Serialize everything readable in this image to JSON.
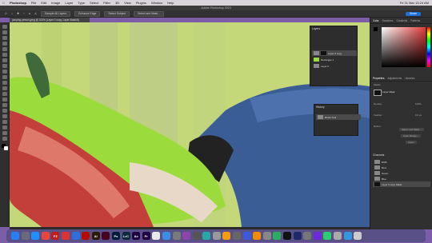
{
  "menubar": {
    "app_name": "Photoshop",
    "items": [
      "File",
      "Edit",
      "Image",
      "Layer",
      "Type",
      "Select",
      "Filter",
      "3D",
      "View",
      "Plugins",
      "Window",
      "Help"
    ],
    "clock": "Fri 31 Mar  13:24 AM"
  },
  "window": {
    "title": "Adobe Photoshop 2023"
  },
  "options_bar": {
    "btn1": "Sample All Layers",
    "btn2": "Enhance Edge",
    "btn3": "Select Subject",
    "btn4": "Select and Mask...",
    "share": "Share"
  },
  "document_tab": "jumping person.jpeg @ 100% (Layer 0 copy, Layer Mask/8)",
  "layers_panel": {
    "title": "Layers",
    "layers": [
      {
        "name": "Layer 0 copy"
      },
      {
        "name": "Rectangle 1"
      },
      {
        "name": "Layer 0"
      }
    ]
  },
  "history_panel": {
    "title": "History",
    "item": "Brush Tool"
  },
  "right_tabs": [
    "Color",
    "Swatches",
    "Gradients",
    "Patterns"
  ],
  "properties": {
    "title": "Properties",
    "tabs": [
      "Properties",
      "Adjustments",
      "Libraries"
    ],
    "mask_label": "Masks",
    "layer_mask": "Layer Mask",
    "density_label": "Density:",
    "density_value": "100%",
    "feather_label": "Feather:",
    "feather_value": "0.0 px",
    "refine_label": "Refine:",
    "btn_select_mask": "Select and Mask...",
    "btn_color_range": "Color Range...",
    "btn_invert": "Invert"
  },
  "channels": {
    "title": "Channels",
    "items": [
      "RGB",
      "Red",
      "Green",
      "Blue",
      "Layer 0 copy Mask"
    ]
  },
  "dock_icons": [
    {
      "name": "finder-icon",
      "label": "",
      "color": "#2a7ff0"
    },
    {
      "name": "launchpad-icon",
      "label": "",
      "color": "#6a6a7a"
    },
    {
      "name": "safari-icon",
      "label": "",
      "color": "#1e90ff"
    },
    {
      "name": "chrome-icon",
      "label": "",
      "color": "#e8453c"
    },
    {
      "name": "filezilla-icon",
      "label": "FZ",
      "color": "#bf1d1d"
    },
    {
      "name": "app-red-icon",
      "label": "",
      "color": "#d33"
    },
    {
      "name": "app-blue-icon",
      "label": "",
      "color": "#2f6fdc"
    },
    {
      "name": "acrobat-icon",
      "label": "",
      "color": "#b30b00"
    },
    {
      "name": "illustrator-icon",
      "label": "Ai",
      "color": "#2b1a03"
    },
    {
      "name": "indesign-icon",
      "label": "",
      "color": "#49021f"
    },
    {
      "name": "photoshop-icon",
      "label": "Ps",
      "color": "#001e36"
    },
    {
      "name": "lightroom-classic-icon",
      "label": "LrC",
      "color": "#0c2a3e"
    },
    {
      "name": "after-effects-icon",
      "label": "Ae",
      "color": "#1f0040"
    },
    {
      "name": "premiere-icon",
      "label": "Pr",
      "color": "#1f0040"
    },
    {
      "name": "preview-icon",
      "label": "",
      "color": "#e9e9e9"
    },
    {
      "name": "app-blue2-icon",
      "label": "",
      "color": "#3a8ee6"
    },
    {
      "name": "app-grey-icon",
      "label": "",
      "color": "#7a7a7a"
    },
    {
      "name": "app-purple-icon",
      "label": "",
      "color": "#8e44ad"
    },
    {
      "name": "app-grey2-icon",
      "label": "",
      "color": "#555"
    },
    {
      "name": "app-teal-icon",
      "label": "",
      "color": "#2aa8a8"
    },
    {
      "name": "app-grey3-icon",
      "label": "",
      "color": "#999"
    },
    {
      "name": "app-orange-icon",
      "label": "",
      "color": "#f39c12"
    },
    {
      "name": "app-grey4-icon",
      "label": "",
      "color": "#666"
    },
    {
      "name": "app-blue3-icon",
      "label": "",
      "color": "#3b5bdb"
    },
    {
      "name": "vlc-icon",
      "label": "",
      "color": "#f08c00"
    },
    {
      "name": "app-grey5-icon",
      "label": "",
      "color": "#888"
    },
    {
      "name": "app-green-icon",
      "label": "",
      "color": "#27ae60"
    },
    {
      "name": "app-black-icon",
      "label": "",
      "color": "#111"
    },
    {
      "name": "app-darkblue-icon",
      "label": "",
      "color": "#1c2a6a"
    },
    {
      "name": "app-grey6-icon",
      "label": "",
      "color": "#777"
    },
    {
      "name": "app-purple2-icon",
      "label": "",
      "color": "#6d28d9"
    },
    {
      "name": "app-green2-icon",
      "label": "",
      "color": "#2ecc71"
    },
    {
      "name": "app-grey7-icon",
      "label": "",
      "color": "#aaa"
    },
    {
      "name": "app-blue4-icon",
      "label": "",
      "color": "#3498db"
    },
    {
      "name": "trash-icon",
      "label": "",
      "color": "#ccc"
    }
  ]
}
